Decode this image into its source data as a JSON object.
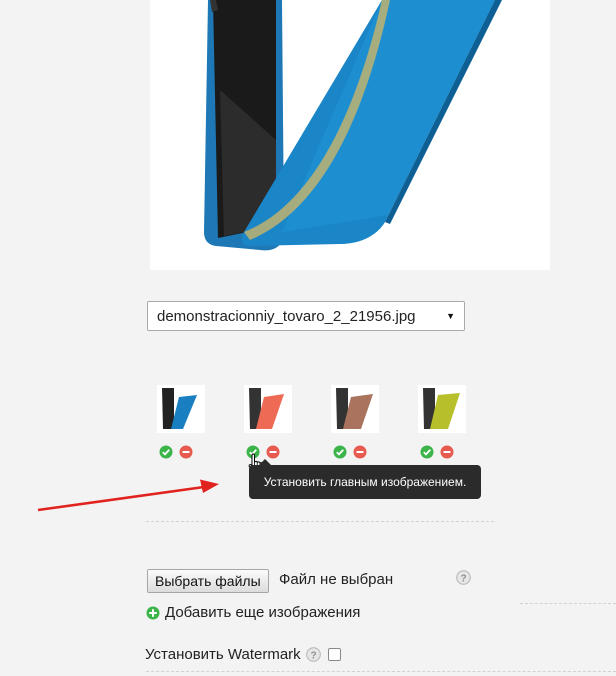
{
  "image_select": {
    "value": "demonstracionniy_tovaro_2_21956.jpg",
    "arrow_icon": "triangle-down-icon"
  },
  "thumbnails": [
    {
      "color": "#1a7fc0",
      "name": "blue"
    },
    {
      "color": "#ef6a55",
      "name": "coral"
    },
    {
      "color": "#a9735d",
      "name": "brown"
    },
    {
      "color": "#b7bf2a",
      "name": "lime"
    }
  ],
  "tooltip": {
    "text": "Установить главным изображением."
  },
  "upload": {
    "button_label": "Выбрать файлы",
    "status": "Файл не выбран"
  },
  "add_more": {
    "label": "Добавить еще изображения"
  },
  "watermark": {
    "label": "Установить Watermark"
  },
  "colors": {
    "accent_green": "#3bb54a",
    "remove_red": "#e65a4f",
    "annotation_arrow": "#e0231f"
  }
}
